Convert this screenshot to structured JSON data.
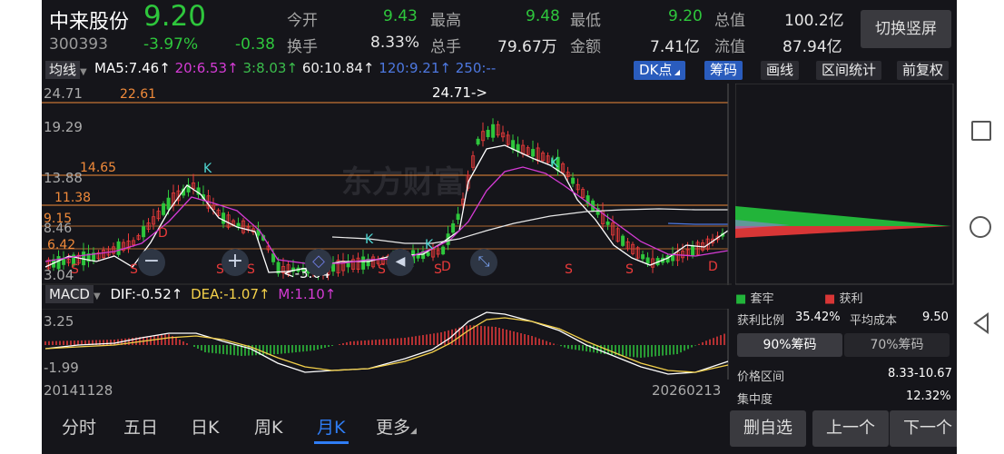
{
  "stock": {
    "name": "中来股份",
    "code": "300393",
    "price": "9.20",
    "change_pct": "-3.97%",
    "change_abs": "-0.38"
  },
  "quote": [
    {
      "label": "今开",
      "value": "9.43"
    },
    {
      "label": "最高",
      "value": "9.48"
    },
    {
      "label": "最低",
      "value": "9.20"
    },
    {
      "label": "总值",
      "value": "100.2亿"
    },
    {
      "label": "换手",
      "value": "8.33%"
    },
    {
      "label": "总手",
      "value": "79.67万"
    },
    {
      "label": "金额",
      "value": "7.41亿"
    },
    {
      "label": "流值",
      "value": "87.94亿"
    }
  ],
  "switch_button": "切换竖屏",
  "ma_bar": {
    "selector": "均线",
    "ma5": "MA5:7.46",
    "ma20": "20:6.53",
    "ma3": "3:8.03",
    "ma60": "60:10.84",
    "ma120": "120:9.21",
    "ma250": "250:--"
  },
  "toolbar": {
    "dk": "DK点",
    "chips": "筹码",
    "draw": "画线",
    "range": "区间统计",
    "adjust": "前复权"
  },
  "price_axis": [
    "24.71",
    "19.29",
    "13.88",
    "9.15",
    "8.46",
    "6.42",
    "3.04"
  ],
  "level_labels": [
    {
      "text": "22.61",
      "color": "#f08a3a"
    },
    {
      "text": "14.65",
      "color": "#f08a3a"
    },
    {
      "text": "11.38",
      "color": "#f08a3a"
    }
  ],
  "annotations": {
    "high": "24.71->",
    "low": "<-3.04"
  },
  "signals": {
    "s": "S",
    "k": "K",
    "d": "D"
  },
  "watermark": "东方财富",
  "macd_bar": {
    "label": "MACD",
    "dif": "DIF:-0.52",
    "dea": "DEA:-1.07",
    "m": "M:1.10"
  },
  "macd_axis": [
    "3.25",
    "-1.99"
  ],
  "dates": {
    "start": "20141128",
    "end": "20260213"
  },
  "chips_panel": {
    "legend_trapped": "套牢",
    "legend_profit": "获利",
    "profit_ratio_label": "获利比例",
    "profit_ratio": "35.42%",
    "avg_cost_label": "平均成本",
    "avg_cost": "9.50",
    "tab_90": "90%筹码",
    "tab_70": "70%筹码",
    "price_range_label": "价格区间",
    "price_range": "8.33-10.67",
    "concentration_label": "集中度",
    "concentration": "12.32%"
  },
  "period_tabs": [
    "分时",
    "五日",
    "日K",
    "周K",
    "月K",
    "更多"
  ],
  "bottom_buttons": {
    "remove": "删自选",
    "prev": "上一个",
    "next": "下一个"
  },
  "colors": {
    "up": "#e83a3a",
    "down": "#2ec63c",
    "accent": "#2f7df5",
    "ma5": "#ffffff",
    "ma20": "#d43bd4",
    "ma_long": "#e8e8e8"
  }
}
